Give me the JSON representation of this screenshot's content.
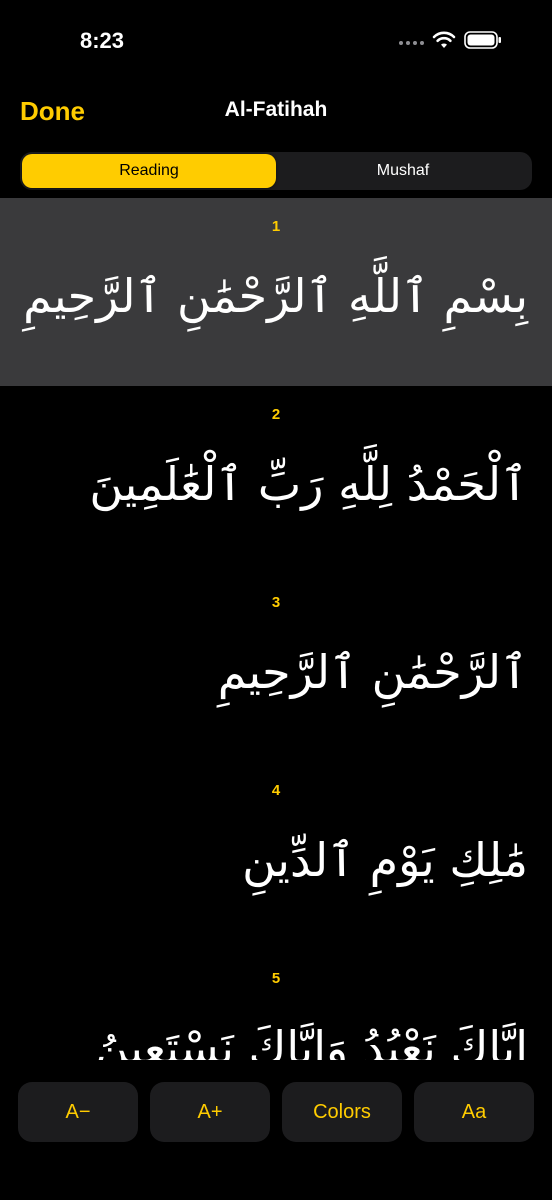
{
  "status": {
    "time": "8:23"
  },
  "nav": {
    "done_label": "Done",
    "title": "Al-Fatihah"
  },
  "segments": [
    {
      "label": "Reading",
      "active": true
    },
    {
      "label": "Mushaf",
      "active": false
    }
  ],
  "verses": [
    {
      "number": "1",
      "text": "بِسْمِ ٱللَّهِ ٱلرَّحْمَٰنِ ٱلرَّحِيمِ",
      "highlighted": true
    },
    {
      "number": "2",
      "text": "ٱلْحَمْدُ لِلَّهِ رَبِّ ٱلْعَٰلَمِينَ",
      "highlighted": false
    },
    {
      "number": "3",
      "text": "ٱلرَّحْمَٰنِ ٱلرَّحِيمِ",
      "highlighted": false
    },
    {
      "number": "4",
      "text": "مَٰلِكِ يَوْمِ ٱلدِّينِ",
      "highlighted": false
    },
    {
      "number": "5",
      "text": "إِيَّاكَ نَعْبُدُ وَإِيَّاكَ نَسْتَعِينُ",
      "highlighted": false
    }
  ],
  "toolbar": {
    "decrease_label": "A−",
    "increase_label": "A+",
    "colors_label": "Colors",
    "font_label": "Aa"
  },
  "colors": {
    "accent": "#ffcc00",
    "background": "#000000",
    "highlight": "#3a3a3c",
    "control_bg": "#1c1c1e"
  }
}
